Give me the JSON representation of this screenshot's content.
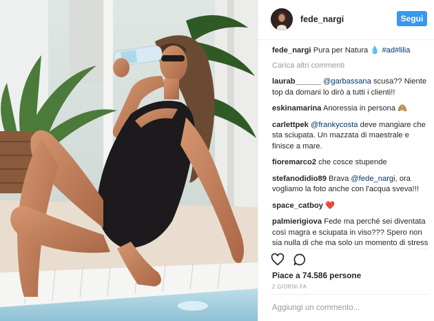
{
  "post": {
    "username": "fede_nargi",
    "follow_label": "Segui",
    "caption_user": "fede_nargi",
    "caption_text": "Pura per Natura 💧",
    "caption_tags": "#ad#lilia",
    "load_more": "Carica altri commenti",
    "comments": [
      {
        "user": "laurab______",
        "mention": "@garbassana",
        "text": " scusa?? Niente top da domani lo dirò a tutti i clienti!!"
      },
      {
        "user": "eskinamarina",
        "mention": "",
        "text": " Anoressia in persona 🙈"
      },
      {
        "user": "carlettpek",
        "mention": "@frankycosta",
        "text": " deve mangiare che sta sciupata. Un mazzata di maestrale e finisce a mare."
      },
      {
        "user": "fioremarco2",
        "mention": "",
        "text": " che cosce stupende"
      },
      {
        "user": "stefanodidio89",
        "mention": "",
        "text": " Brava ",
        "mention2": "@fede_nargi",
        "text2": ", ora vogliamo la foto anche con l'acqua sveva!!!"
      },
      {
        "user": "space_catboy",
        "mention": "",
        "text": " ❤️"
      },
      {
        "user": "palmierigiova",
        "mention": "",
        "text": " Fede ma perché sei diventata così magra e sciupata in viso??? Spero non sia nulla di che ma solo un momento di stress"
      }
    ],
    "likes": "Piace a 74.586 persone",
    "time": "2 GIORNI FA",
    "add_comment_placeholder": "Aggiungi un commento..."
  },
  "icons": {
    "like": "heart-icon",
    "comment": "comment-bubble-icon"
  },
  "colors": {
    "accent": "#3897f0",
    "mention": "#003569",
    "muted": "#999999"
  }
}
